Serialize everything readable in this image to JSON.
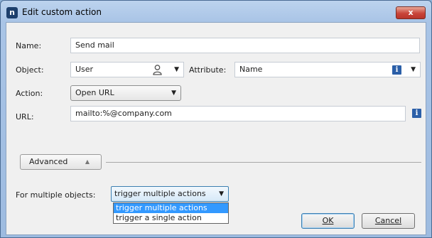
{
  "window": {
    "title": "Edit custom action",
    "app_icon": "n",
    "close_label": "x"
  },
  "fields": {
    "name_label": "Name:",
    "name_value": "Send mail",
    "object_label": "Object:",
    "object_value": "User",
    "attribute_label": "Attribute:",
    "attribute_value": "Name",
    "action_label": "Action:",
    "action_value": "Open URL",
    "url_label": "URL:",
    "url_value": "mailto:%@company.com"
  },
  "advanced": {
    "label": "Advanced"
  },
  "multiple": {
    "label": "For multiple objects:",
    "selected": "trigger multiple actions",
    "options": [
      "trigger multiple actions",
      "trigger a single action"
    ]
  },
  "buttons": {
    "ok": "OK",
    "cancel": "Cancel"
  },
  "icons": {
    "info": "info-icon",
    "user": "user-icon",
    "dropdown": "chevron-down-icon"
  },
  "colors": {
    "title_bar": "#a9c4e6",
    "selection": "#3399ff",
    "info": "#2b5fa8",
    "close": "#c9453a"
  }
}
